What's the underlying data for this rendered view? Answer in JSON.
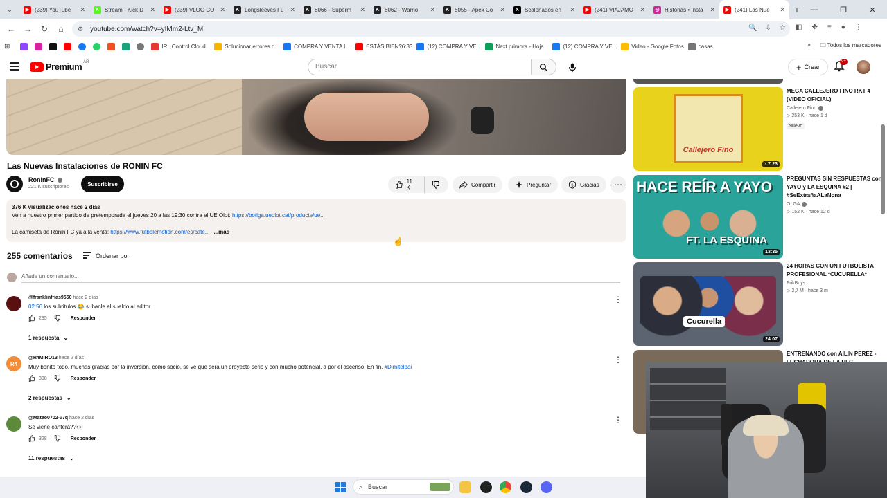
{
  "browser": {
    "tabs": [
      {
        "title": "(239) YouTube",
        "fav_color": "#ff0000",
        "fav": "▶"
      },
      {
        "title": "Stream - Kick D",
        "fav_color": "#53fc18",
        "fav": "K"
      },
      {
        "title": "(239) VLOG CO",
        "fav_color": "#ff0000",
        "fav": "▶"
      },
      {
        "title": "Longsleeves Fu",
        "fav_color": "#222222",
        "fav": "K"
      },
      {
        "title": "8066 - Superm",
        "fav_color": "#222222",
        "fav": "K"
      },
      {
        "title": "8062 - Warrio",
        "fav_color": "#222222",
        "fav": "K"
      },
      {
        "title": "8055 - Apex Co",
        "fav_color": "#222222",
        "fav": "K"
      },
      {
        "title": "Scalonados en",
        "fav_color": "#000000",
        "fav": "X"
      },
      {
        "title": "(241) VIAJAMO",
        "fav_color": "#ff0000",
        "fav": "▶"
      },
      {
        "title": "Historias • Insta",
        "fav_color": "#d6249f",
        "fav": "◎"
      },
      {
        "title": "(241) Las Nue",
        "fav_color": "#ff0000",
        "fav": "▶"
      }
    ],
    "url": "youtube.com/watch?v=yIMm2-Ltv_M",
    "bookmarks": [
      {
        "label": "IRL Control Cloud...",
        "color": "#e53935"
      },
      {
        "label": "Solucionar errores d...",
        "color": "#f4b400"
      },
      {
        "label": "COMPRA Y VENTA L...",
        "color": "#1877f2"
      },
      {
        "label": "ESTÁS BIEN?6:33",
        "color": "#ff0000"
      },
      {
        "label": "(12) COMPRA Y VE...",
        "color": "#1877f2"
      },
      {
        "label": "Next primora - Hoja...",
        "color": "#0f9d58"
      },
      {
        "label": "(12) COMPRA Y VE...",
        "color": "#1877f2"
      },
      {
        "label": "Video - Google Fotos",
        "color": "#fbbc04"
      },
      {
        "label": "casas",
        "color": "#777777"
      }
    ],
    "all_bookmarks": "Todos los marcadores"
  },
  "yt_header": {
    "logo": "Premium",
    "logo_country": "AR",
    "search_placeholder": "Buscar",
    "create_label": "Crear",
    "notif_badge": "9+"
  },
  "video": {
    "title": "Las Nuevas Instalaciones de RONIN FC",
    "channel": "RoninFC",
    "subscribers": "221 K suscriptores",
    "subscribe_label": "Suscribirse",
    "likes": "11 K",
    "share_label": "Compartir",
    "ask_label": "Preguntar",
    "thanks_label": "Gracias",
    "desc_meta": "376 K visualizaciones  hace 2 días",
    "desc_line1": "Ven a nuestro primer partido de pretemporada el jueves 20 a las 19:30 contra el UE Olot: ",
    "desc_link1": "https://botiga.ueolot.cat/producte/ue...",
    "desc_line2": "La camiseta de Rōnin FC ya a la venta: ",
    "desc_link2": "https://www.futbolemotion.com/es/cate...",
    "desc_more": "...más"
  },
  "comments": {
    "count_label": "255 comentarios",
    "sort_label": "Ordenar por",
    "add_placeholder": "Añade un comentario...",
    "items": [
      {
        "user": "@franklinfrias9550",
        "when": "hace 2 días",
        "ts": "02:56",
        "text": " los subtitulos 😂  subanle el sueldo al editor",
        "likes": "235",
        "reply": "Responder",
        "replies": "1 respuesta",
        "av_color": "#5a1010",
        "av_text": ""
      },
      {
        "user": "@R4MIRO13",
        "when": "hace 2 días",
        "ts": "",
        "text": "Muy bonito todo, muchas gracias por la inversión, como socio, se ve que será un proyecto serio y con mucho potencial, a por el ascenso! En fin, ",
        "hashtag": "#Dimitelbai",
        "likes": "308",
        "reply": "Responder",
        "replies": "2 respuestas",
        "av_color": "#f28c38",
        "av_text": "R4"
      },
      {
        "user": "@Mateo0702-v7q",
        "when": "hace 2 días",
        "ts": "",
        "text": "Se viene cantera??👀",
        "likes": "328",
        "reply": "Responder",
        "replies": "11 respuestas",
        "av_color": "#5c8a3a",
        "av_text": ""
      }
    ]
  },
  "recommendations": [
    {
      "title": "MEGA CALLEJERO FINO RKT 4 (VIDEO OFICIAL)",
      "channel": "Callejero Fino",
      "verified": true,
      "stats": "▷ 253 K · hace 1 d",
      "badge": "Nuevo",
      "duration": "♪ 7:23",
      "thumb_text": "Callejero Fino",
      "thumb_bg": "#e8d21c"
    },
    {
      "title": "PREGUNTAS SIN RESPUESTAS con YAYO y LA ESQUINA #2 | #SeExtrañaALaNona",
      "channel": "OLGA",
      "verified": true,
      "stats": "▷ 152 K · hace 12 d",
      "badge": "",
      "duration": "13:35",
      "thumb_text": "HACE REÍR A YAYO",
      "thumb_text2": "FT. LA ESQUINA",
      "thumb_bg": "#2aa39a"
    },
    {
      "title": "24 HORAS CON UN FUTBOLISTA PROFESIONAL *CUCURELLA*",
      "channel": "FrikBoys",
      "verified": false,
      "stats": "▷ 2,7 M · hace 3 m",
      "badge": "",
      "duration": "24:07",
      "thumb_text": "Cucurella",
      "thumb_bg": "#5b6470"
    },
    {
      "title": "ENTRENANDO con AILIN PEREZ - LUCHADORA DE LA UFC",
      "channel": "",
      "verified": false,
      "stats": "",
      "badge": "",
      "duration": "",
      "thumb_text": "",
      "thumb_bg": "#7a6a5a"
    }
  ],
  "taskbar": {
    "search_label": "Buscar"
  }
}
